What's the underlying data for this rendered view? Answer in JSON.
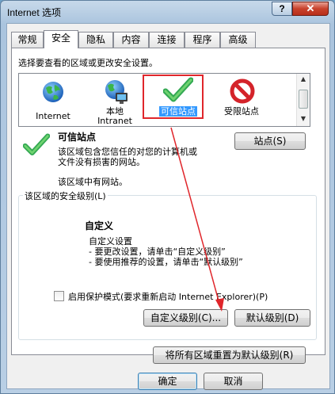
{
  "window": {
    "title": "Internet 选项",
    "help_label": "?",
    "close_label": "✕"
  },
  "tabs": [
    {
      "label": "常规",
      "active": false
    },
    {
      "label": "安全",
      "active": true
    },
    {
      "label": "隐私",
      "active": false
    },
    {
      "label": "内容",
      "active": false
    },
    {
      "label": "连接",
      "active": false
    },
    {
      "label": "程序",
      "active": false
    },
    {
      "label": "高级",
      "active": false
    }
  ],
  "security": {
    "instruction": "选择要查看的区域或更改安全设置。",
    "zones": [
      {
        "label": "Internet",
        "icon": "globe-icon",
        "selected": false
      },
      {
        "label": "本地\nIntranet",
        "icon": "intranet-icon",
        "selected": false
      },
      {
        "label": "可信站点",
        "icon": "checkmark-icon",
        "selected": true
      },
      {
        "label": "受限站点",
        "icon": "restricted-icon",
        "selected": false
      }
    ],
    "zone_title": "可信站点",
    "sites_button": "站点(S)",
    "zone_description_1": "该区域包含您信任的对您的计算机或",
    "zone_description_2": "文件没有损害的网站。",
    "zone_site_note": "该区域中有网站。",
    "level_group_title": "该区域的安全级别(L)",
    "level_name": "自定义",
    "level_line_1": "自定义设置",
    "level_line_2": "- 要更改设置，请单击“自定义级别”",
    "level_line_3": "- 要使用推荐的设置，请单击“默认级别”",
    "protected_mode_label": "启用保护模式(要求重新启动 Internet Explorer)(P)",
    "protected_mode_checked": false,
    "custom_level_button": "自定义级别(C)...",
    "default_level_button": "默认级别(D)",
    "reset_all_button": "将所有区域重置为默认级别(R)"
  },
  "footer": {
    "ok_button": "确定",
    "cancel_button": "取消"
  },
  "colors": {
    "accent_selection": "#3399ff",
    "highlight_box": "#e0262b",
    "annotation_arrow": "#e0262b"
  }
}
